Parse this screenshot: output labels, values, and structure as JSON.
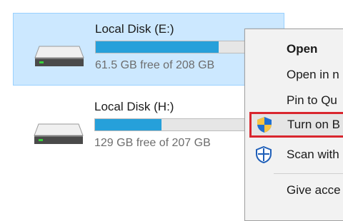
{
  "drives": [
    {
      "name": "Local Disk (E:)",
      "free_text": "61.5 GB free of 208 GB",
      "used_fraction": 0.7,
      "selected": true
    },
    {
      "name": "Local Disk (H:)",
      "free_text": "129 GB free of 207 GB",
      "used_fraction": 0.38,
      "selected": false
    }
  ],
  "context_menu": {
    "items": [
      {
        "label": "Open",
        "bold": true
      },
      {
        "label": "Open in n"
      },
      {
        "label": "Pin to Qu"
      },
      {
        "label": "Turn on B",
        "icon": "shield-icon",
        "highlighted": true
      },
      {
        "label": "Scan with",
        "icon": "defender-icon"
      },
      {
        "label": "Give acce"
      }
    ]
  },
  "colors": {
    "selection_bg": "#cce8ff",
    "bar_fill": "#26a0da",
    "highlight_border": "#d9262e"
  }
}
